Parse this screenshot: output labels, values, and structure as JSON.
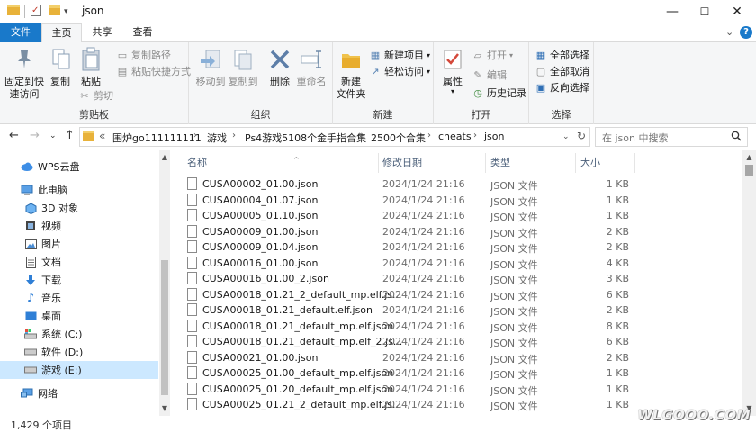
{
  "window": {
    "title": "json",
    "minimize": "—",
    "maximize": "☐",
    "close": "✕"
  },
  "ribbon_tabs": {
    "file": "文件",
    "home": "主页",
    "share": "共享",
    "view": "查看",
    "expand": "⌄"
  },
  "ribbon": {
    "clipboard": {
      "label": "剪贴板",
      "pin": "固定到快\n速访问",
      "copy": "复制",
      "paste": "粘贴",
      "copy_path": "复制路径",
      "paste_shortcut": "粘贴快捷方式",
      "cut": "剪切"
    },
    "organize": {
      "label": "组织",
      "move_to": "移动到",
      "copy_to": "复制到",
      "delete": "删除",
      "rename": "重命名"
    },
    "new": {
      "label": "新建",
      "new_folder": "新建\n文件夹",
      "new_item": "新建项目",
      "easy_access": "轻松访问"
    },
    "open": {
      "label": "打开",
      "properties": "属性",
      "open": "打开",
      "edit": "编辑",
      "history": "历史记录"
    },
    "select": {
      "label": "选择",
      "select_all": "全部选择",
      "select_none": "全部取消",
      "invert": "反向选择"
    }
  },
  "address": {
    "overflow": "«",
    "crumbs": [
      "围炉go111111111",
      "游戏",
      "Ps4游戏5108个金手指合集",
      "2500个合集",
      "cheats",
      "json"
    ],
    "search_placeholder": "在 json 中搜索"
  },
  "nav": {
    "items": [
      {
        "label": "WPS云盘",
        "icon": "cloud-icon"
      },
      {
        "label": "此电脑",
        "icon": "computer-icon"
      },
      {
        "label": "3D 对象",
        "icon": "3d-objects-icon"
      },
      {
        "label": "视频",
        "icon": "video-icon"
      },
      {
        "label": "图片",
        "icon": "pictures-icon"
      },
      {
        "label": "文档",
        "icon": "documents-icon"
      },
      {
        "label": "下载",
        "icon": "download-icon"
      },
      {
        "label": "音乐",
        "icon": "music-icon"
      },
      {
        "label": "桌面",
        "icon": "desktop-icon"
      },
      {
        "label": "系统 (C:)",
        "icon": "drive-icon"
      },
      {
        "label": "软件 (D:)",
        "icon": "drive-icon"
      },
      {
        "label": "游戏 (E:)",
        "icon": "drive-icon"
      },
      {
        "label": "网络",
        "icon": "network-icon"
      }
    ]
  },
  "columns": {
    "name": "名称",
    "date": "修改日期",
    "type": "类型",
    "size": "大小"
  },
  "files": [
    {
      "name": "CUSA00002_01.00.json",
      "date": "2024/1/24 21:16",
      "type": "JSON 文件",
      "size": "1 KB"
    },
    {
      "name": "CUSA00004_01.07.json",
      "date": "2024/1/24 21:16",
      "type": "JSON 文件",
      "size": "1 KB"
    },
    {
      "name": "CUSA00005_01.10.json",
      "date": "2024/1/24 21:16",
      "type": "JSON 文件",
      "size": "1 KB"
    },
    {
      "name": "CUSA00009_01.00.json",
      "date": "2024/1/24 21:16",
      "type": "JSON 文件",
      "size": "2 KB"
    },
    {
      "name": "CUSA00009_01.04.json",
      "date": "2024/1/24 21:16",
      "type": "JSON 文件",
      "size": "2 KB"
    },
    {
      "name": "CUSA00016_01.00.json",
      "date": "2024/1/24 21:16",
      "type": "JSON 文件",
      "size": "4 KB"
    },
    {
      "name": "CUSA00016_01.00_2.json",
      "date": "2024/1/24 21:16",
      "type": "JSON 文件",
      "size": "3 KB"
    },
    {
      "name": "CUSA00018_01.21_2_default_mp.elf.js...",
      "date": "2024/1/24 21:16",
      "type": "JSON 文件",
      "size": "6 KB"
    },
    {
      "name": "CUSA00018_01.21_default.elf.json",
      "date": "2024/1/24 21:16",
      "type": "JSON 文件",
      "size": "2 KB"
    },
    {
      "name": "CUSA00018_01.21_default_mp.elf.json",
      "date": "2024/1/24 21:16",
      "type": "JSON 文件",
      "size": "8 KB"
    },
    {
      "name": "CUSA00018_01.21_default_mp.elf_2.js...",
      "date": "2024/1/24 21:16",
      "type": "JSON 文件",
      "size": "6 KB"
    },
    {
      "name": "CUSA00021_01.00.json",
      "date": "2024/1/24 21:16",
      "type": "JSON 文件",
      "size": "2 KB"
    },
    {
      "name": "CUSA00025_01.00_default_mp.elf.json",
      "date": "2024/1/24 21:16",
      "type": "JSON 文件",
      "size": "1 KB"
    },
    {
      "name": "CUSA00025_01.20_default_mp.elf.json",
      "date": "2024/1/24 21:16",
      "type": "JSON 文件",
      "size": "1 KB"
    },
    {
      "name": "CUSA00025_01.21_2_default_mp.elf.js...",
      "date": "2024/1/24 21:16",
      "type": "JSON 文件",
      "size": "1 KB"
    }
  ],
  "status": {
    "item_count": "1,429 个项目"
  },
  "watermark": "WLGOOO.COM"
}
